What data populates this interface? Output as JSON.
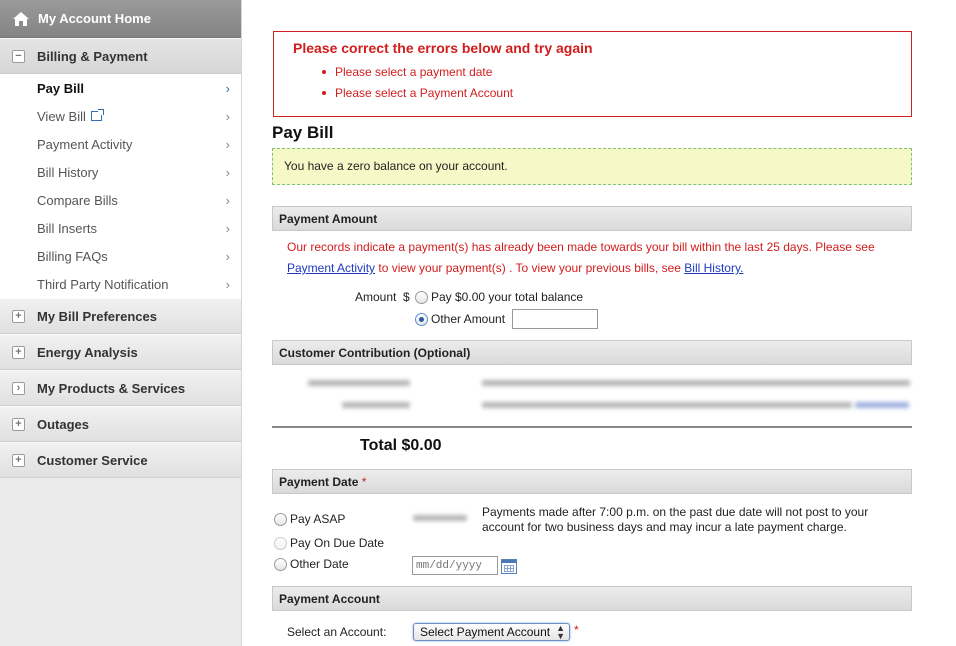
{
  "sidebar": {
    "home_label": "My Account Home",
    "billing_section": "Billing & Payment",
    "billing_items": [
      {
        "label": "Pay Bill"
      },
      {
        "label": "View Bill"
      },
      {
        "label": "Payment Activity"
      },
      {
        "label": "Bill History"
      },
      {
        "label": "Compare Bills"
      },
      {
        "label": "Bill Inserts"
      },
      {
        "label": "Billing FAQs"
      },
      {
        "label": "Third Party Notification"
      }
    ],
    "sections": [
      {
        "label": "My Bill Preferences"
      },
      {
        "label": "Energy Analysis"
      },
      {
        "label": "My Products & Services"
      },
      {
        "label": "Outages"
      },
      {
        "label": "Customer Service"
      }
    ]
  },
  "errors": {
    "title": "Please correct the errors below and try again",
    "items": [
      "Please select a payment date",
      "Please select a Payment Account"
    ]
  },
  "page_title": "Pay Bill",
  "notice": "You have a zero balance on your account.",
  "payment_amount": {
    "header": "Payment Amount",
    "info_prefix": "Our records indicate a payment(s) has already been made towards your bill within the last 25 days. Please see",
    "link_activity": "Payment Activity",
    "info_middle": "to view your payment(s) . To view your previous bills, see",
    "link_history": "Bill History.",
    "amount_label": "Amount",
    "currency": "$",
    "option_total": "Pay $0.00 your total balance",
    "option_other": "Other Amount",
    "other_value": ""
  },
  "contribution": {
    "header": "Customer Contribution (Optional)"
  },
  "total": "Total $0.00",
  "payment_date": {
    "header": "Payment Date",
    "required_mark": "*",
    "option_asap": "Pay ASAP",
    "option_due": "Pay On Due Date",
    "option_other": "Other Date",
    "date_placeholder": "mm/dd/yyyy",
    "note": "Payments made after 7:00 p.m. on the past due date will not post to your account for two business days and may incur a late payment charge."
  },
  "payment_account": {
    "header": "Payment Account",
    "select_label": "Select an Account:",
    "select_value": "Select Payment Account",
    "required_mark": "*"
  }
}
